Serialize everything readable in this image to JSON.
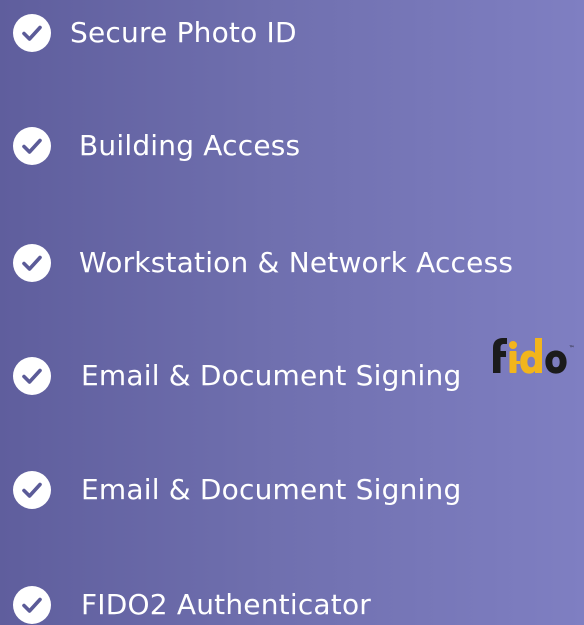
{
  "features": [
    {
      "label": "Secure Photo ID",
      "icon": "check-circle-icon"
    },
    {
      "label": "Building Access",
      "icon": "check-circle-icon"
    },
    {
      "label": "Workstation & Network Access",
      "icon": "check-circle-icon"
    },
    {
      "label": "Email & Document Signing",
      "icon": "check-circle-icon"
    },
    {
      "label": "Email & Document Signing",
      "icon": "check-circle-icon"
    },
    {
      "label": "FIDO2 Authenticator",
      "icon": "check-circle-icon"
    }
  ],
  "logo": {
    "text": "fido",
    "trademark": "™",
    "colors": {
      "dark": "#1b1b1b",
      "yellow": "#f2b51c"
    }
  },
  "colors": {
    "background_left": "#5f5e9d",
    "background_right": "#7f7fc2",
    "check_fill": "#ffffff",
    "check_mark": "#5b5b98",
    "text": "#ffffff"
  }
}
